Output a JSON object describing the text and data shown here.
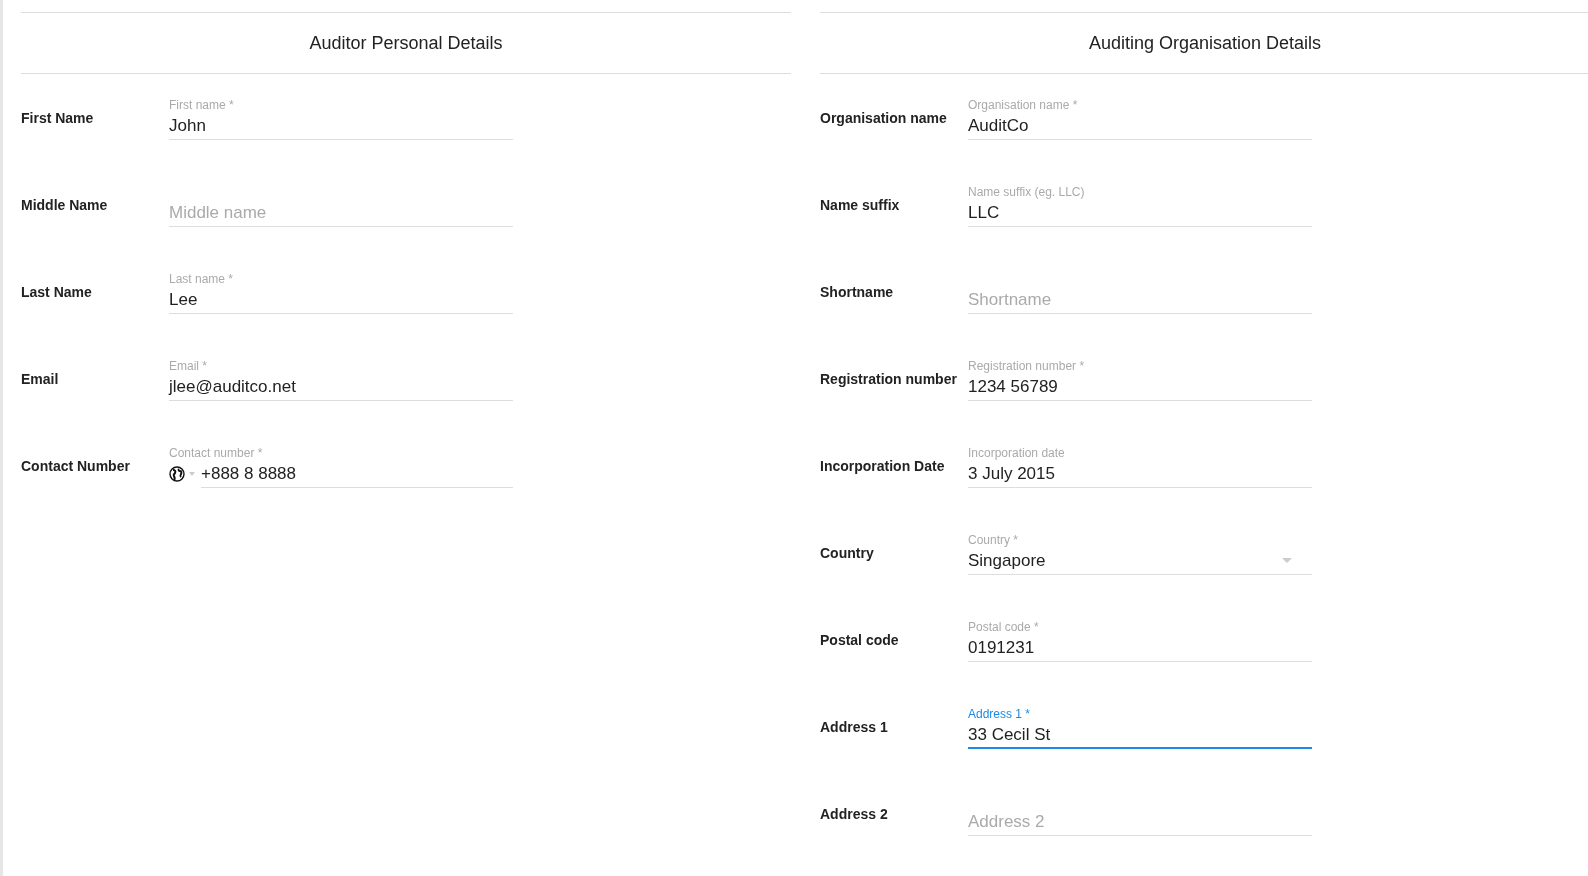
{
  "sections": [
    {
      "title": "Auditor Personal Details",
      "fields": [
        {
          "kind": "text",
          "label": "First Name",
          "float_label": "First name *",
          "value": "John",
          "focused": false
        },
        {
          "kind": "text",
          "label": "Middle Name",
          "placeholder": "Middle name",
          "focused": false
        },
        {
          "kind": "text",
          "label": "Last Name",
          "float_label": "Last name *",
          "value": "Lee",
          "focused": false
        },
        {
          "kind": "text",
          "label": "Email",
          "float_label": "Email *",
          "value": "jlee@auditco.net",
          "focused": false
        },
        {
          "kind": "phone",
          "label": "Contact Number",
          "float_label": "Contact number *",
          "value": "+888 8 8888",
          "focused": false
        }
      ]
    },
    {
      "title": "Auditing Organisation Details",
      "fields": [
        {
          "kind": "text",
          "label": "Organisation name",
          "float_label": "Organisation name *",
          "value": "AuditCo",
          "focused": false
        },
        {
          "kind": "text",
          "label": "Name suffix",
          "float_label": "Name suffix (eg. LLC)",
          "value": "LLC",
          "focused": false
        },
        {
          "kind": "text",
          "label": "Shortname",
          "placeholder": "Shortname",
          "focused": false
        },
        {
          "kind": "text",
          "label": "Registration number",
          "float_label": "Registration number *",
          "value": "1234 56789",
          "focused": false
        },
        {
          "kind": "text",
          "label": "Incorporation Date",
          "float_label": "Incorporation date",
          "value": "3 July 2015",
          "focused": false
        },
        {
          "kind": "select",
          "label": "Country",
          "float_label": "Country *",
          "value": "Singapore",
          "focused": false
        },
        {
          "kind": "text",
          "label": "Postal code",
          "float_label": "Postal code *",
          "value": "0191231",
          "focused": false
        },
        {
          "kind": "text",
          "label": "Address 1",
          "float_label": "Address 1 *",
          "value": "33 Cecil St",
          "focused": true
        },
        {
          "kind": "text",
          "label": "Address 2",
          "placeholder": "Address 2",
          "focused": false
        }
      ]
    }
  ]
}
